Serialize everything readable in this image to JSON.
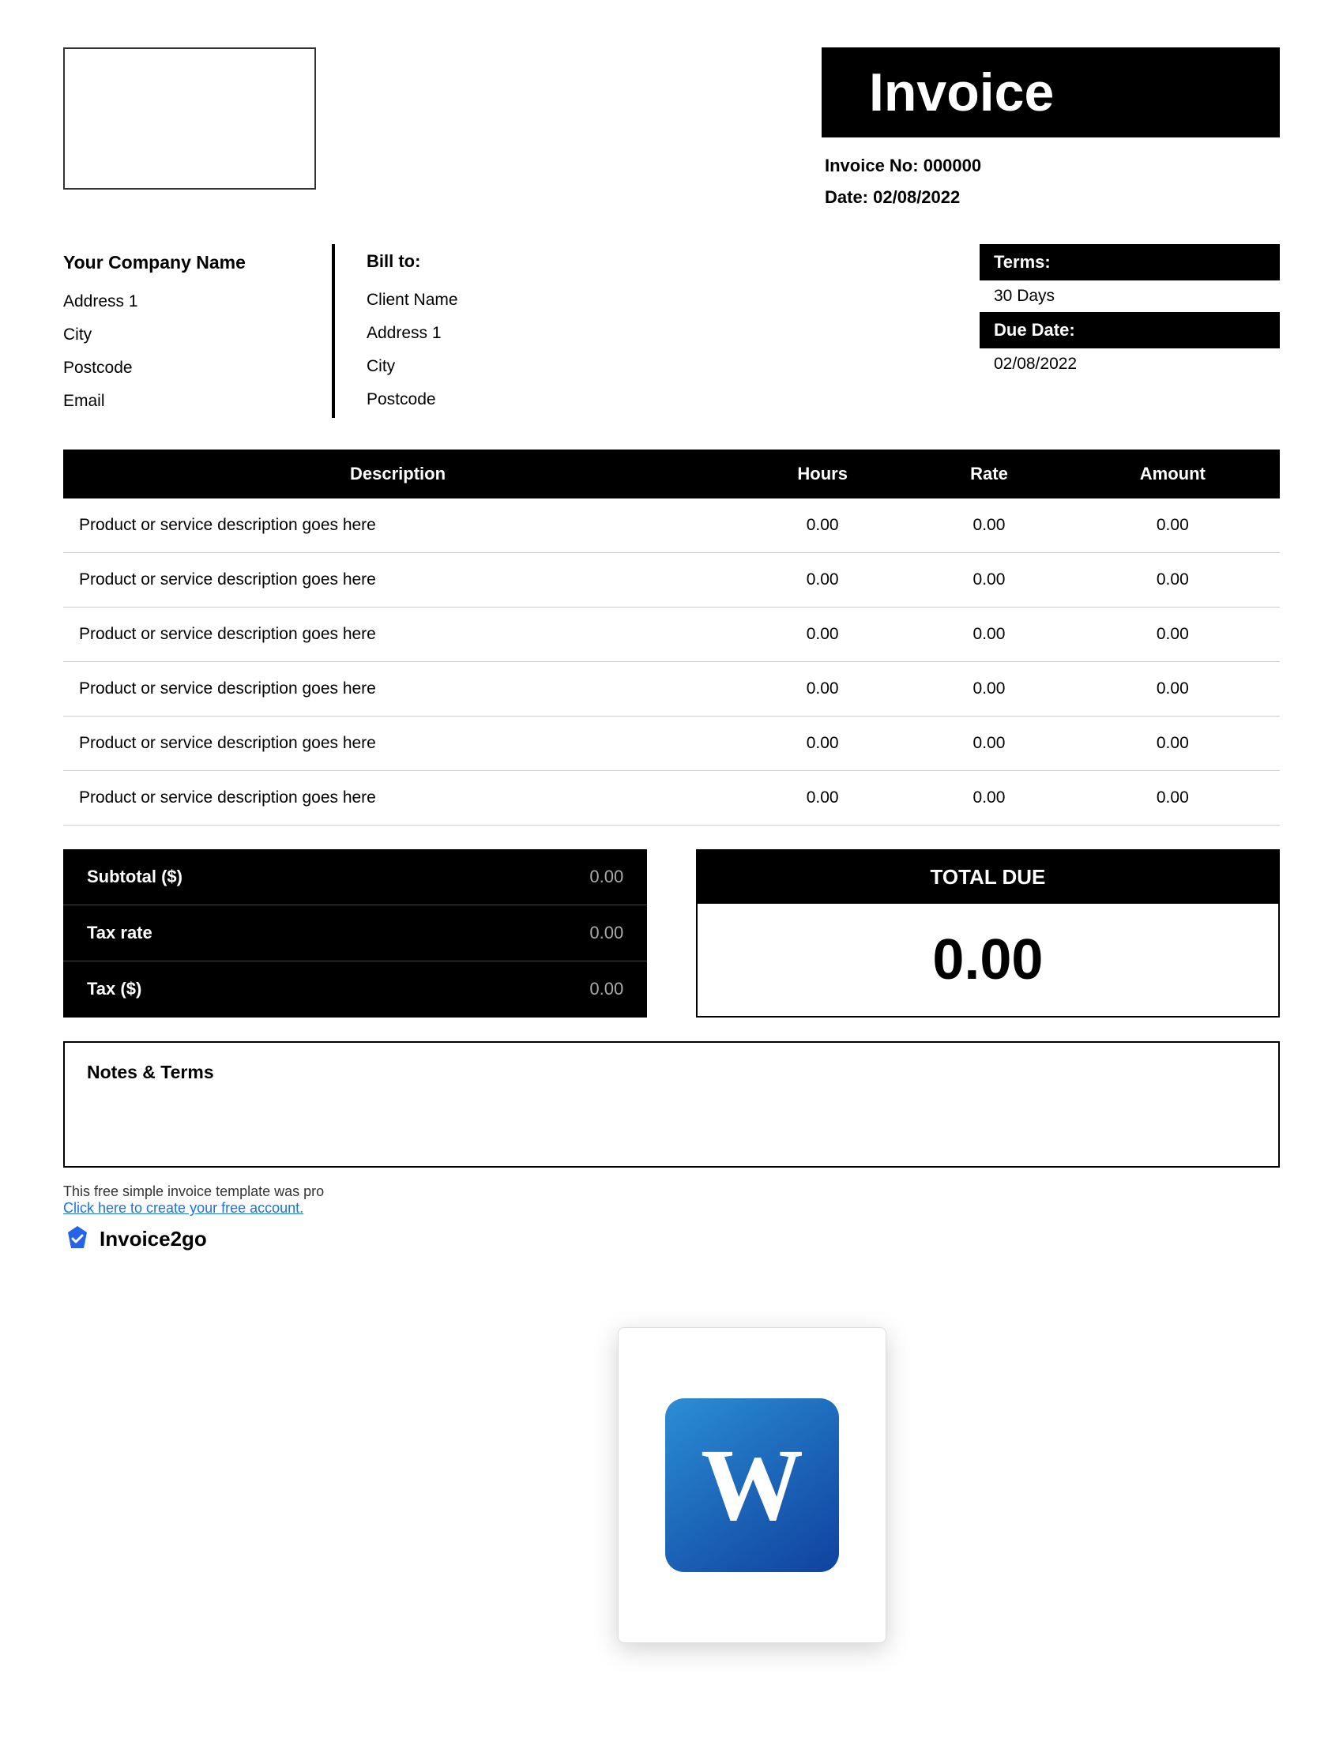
{
  "header": {
    "invoice_title": "Invoice",
    "invoice_no_label": "Invoice No:",
    "invoice_no_value": "000000",
    "date_label": "Date:",
    "date_value": "02/08/2022"
  },
  "company": {
    "name": "Your Company Name",
    "address1": "Address 1",
    "city": "City",
    "postcode": "Postcode",
    "email": "Email"
  },
  "bill_to": {
    "label": "Bill to:",
    "client_name": "Client Name",
    "address1": "Address 1",
    "city": "City",
    "postcode": "Postcode"
  },
  "terms": {
    "label": "Terms:",
    "value": "30 Days",
    "due_date_label": "Due Date:",
    "due_date_value": "02/08/2022"
  },
  "table": {
    "headers": [
      "Description",
      "Hours",
      "Rate",
      "Amount"
    ],
    "rows": [
      {
        "description": "Product or service description goes here",
        "hours": "0.00",
        "rate": "0.00",
        "amount": "0.00"
      },
      {
        "description": "Product or service description goes here",
        "hours": "0.00",
        "rate": "0.00",
        "amount": "0.00"
      },
      {
        "description": "Product or service description goes here",
        "hours": "0.00",
        "rate": "0.00",
        "amount": "0.00"
      },
      {
        "description": "Product or service description goes here",
        "hours": "0.00",
        "rate": "0.00",
        "amount": "0.00"
      },
      {
        "description": "Product or service description goes here",
        "hours": "0.00",
        "rate": "0.00",
        "amount": "0.00"
      },
      {
        "description": "Product or service description goes here",
        "hours": "0.00",
        "rate": "0.00",
        "amount": "0.00"
      }
    ]
  },
  "subtotal": {
    "subtotal_label": "Subtotal ($)",
    "subtotal_value": "0.00",
    "tax_rate_label": "Tax rate",
    "tax_rate_value": "0.00",
    "tax_label": "Tax ($)",
    "tax_value": "0.00"
  },
  "total_due": {
    "label": "TOTAL DUE",
    "value": "0.00"
  },
  "notes": {
    "title": "Notes & Terms",
    "content": ""
  },
  "footer": {
    "promo_text": "This free simple invoice template was pro",
    "link_text": "Click here to create your free account.",
    "brand_name": "Invoice2go"
  }
}
